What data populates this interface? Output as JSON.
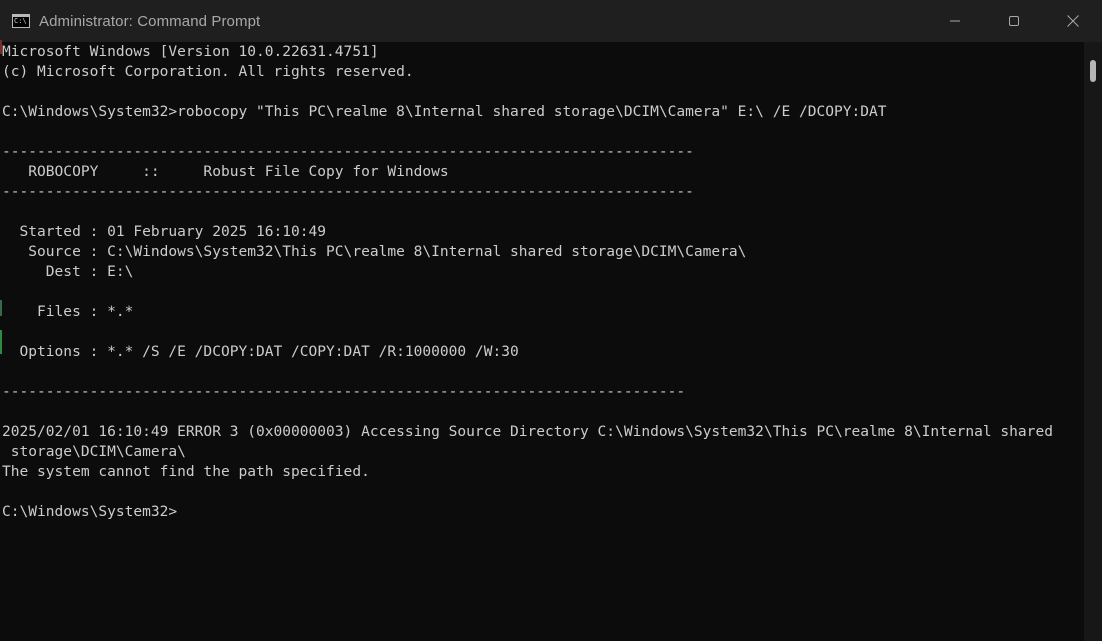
{
  "window": {
    "title": "Administrator: Command Prompt",
    "app_icon_text": "C:\\"
  },
  "controls": {
    "minimize": "minimize-icon",
    "maximize": "maximize-icon",
    "close": "close-icon"
  },
  "console": {
    "lines": [
      "Microsoft Windows [Version 10.0.22631.4751]",
      "(c) Microsoft Corporation. All rights reserved.",
      "",
      "C:\\Windows\\System32>robocopy \"This PC\\realme 8\\Internal shared storage\\DCIM\\Camera\" E:\\ /E /DCOPY:DAT",
      "",
      "-------------------------------------------------------------------------------",
      "   ROBOCOPY     ::     Robust File Copy for Windows",
      "-------------------------------------------------------------------------------",
      "",
      "  Started : 01 February 2025 16:10:49",
      "   Source : C:\\Windows\\System32\\This PC\\realme 8\\Internal shared storage\\DCIM\\Camera\\",
      "     Dest : E:\\",
      "",
      "    Files : *.*",
      "",
      "  Options : *.* /S /E /DCOPY:DAT /COPY:DAT /R:1000000 /W:30",
      "",
      "------------------------------------------------------------------------------",
      "",
      "2025/02/01 16:10:49 ERROR 3 (0x00000003) Accessing Source Directory C:\\Windows\\System32\\This PC\\realme 8\\Internal shared",
      " storage\\DCIM\\Camera\\",
      "The system cannot find the path specified.",
      "",
      "C:\\Windows\\System32>"
    ]
  },
  "colors": {
    "background": "#0c0c0c",
    "titlebar": "#1f1f1f",
    "text": "#cccccc",
    "title_text": "#a8a8a8"
  }
}
